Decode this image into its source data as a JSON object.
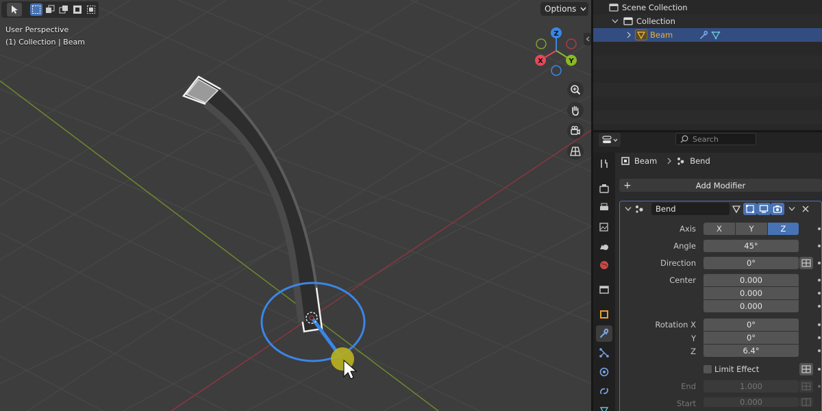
{
  "viewport": {
    "options_label": "Options",
    "perspective_label": "User Perspective",
    "context_label": "(1) Collection | Beam",
    "gizmo": {
      "x": "X",
      "y": "Y",
      "z": "Z"
    }
  },
  "outliner": {
    "scene_collection": "Scene Collection",
    "collection": "Collection",
    "object": "Beam"
  },
  "properties": {
    "search_placeholder": "Search",
    "breadcrumb_object": "Beam",
    "breadcrumb_modifier": "Bend",
    "add_modifier_label": "Add Modifier",
    "modifier": {
      "name": "Bend",
      "axis_label": "Axis",
      "axis_options": [
        "X",
        "Y",
        "Z"
      ],
      "axis_selected": "Z",
      "angle_label": "Angle",
      "angle_value": "45°",
      "direction_label": "Direction",
      "direction_value": "0°",
      "center_label": "Center",
      "center_values": [
        "0.000",
        "0.000",
        "0.000"
      ],
      "rotation_x_label": "Rotation X",
      "rotation_x_value": "0°",
      "rotation_y_label": "Y",
      "rotation_y_value": "0°",
      "rotation_z_label": "Z",
      "rotation_z_value": "6.4°",
      "limit_effect_label": "Limit Effect",
      "end_label": "End",
      "end_value": "1.000",
      "start_label": "Start",
      "start_value": "0.000"
    }
  },
  "colors": {
    "accent": "#4772b3",
    "object_name": "#e8b23a",
    "axis_x": "#e8475a",
    "axis_y": "#8bb826",
    "axis_z": "#3a86e6"
  }
}
